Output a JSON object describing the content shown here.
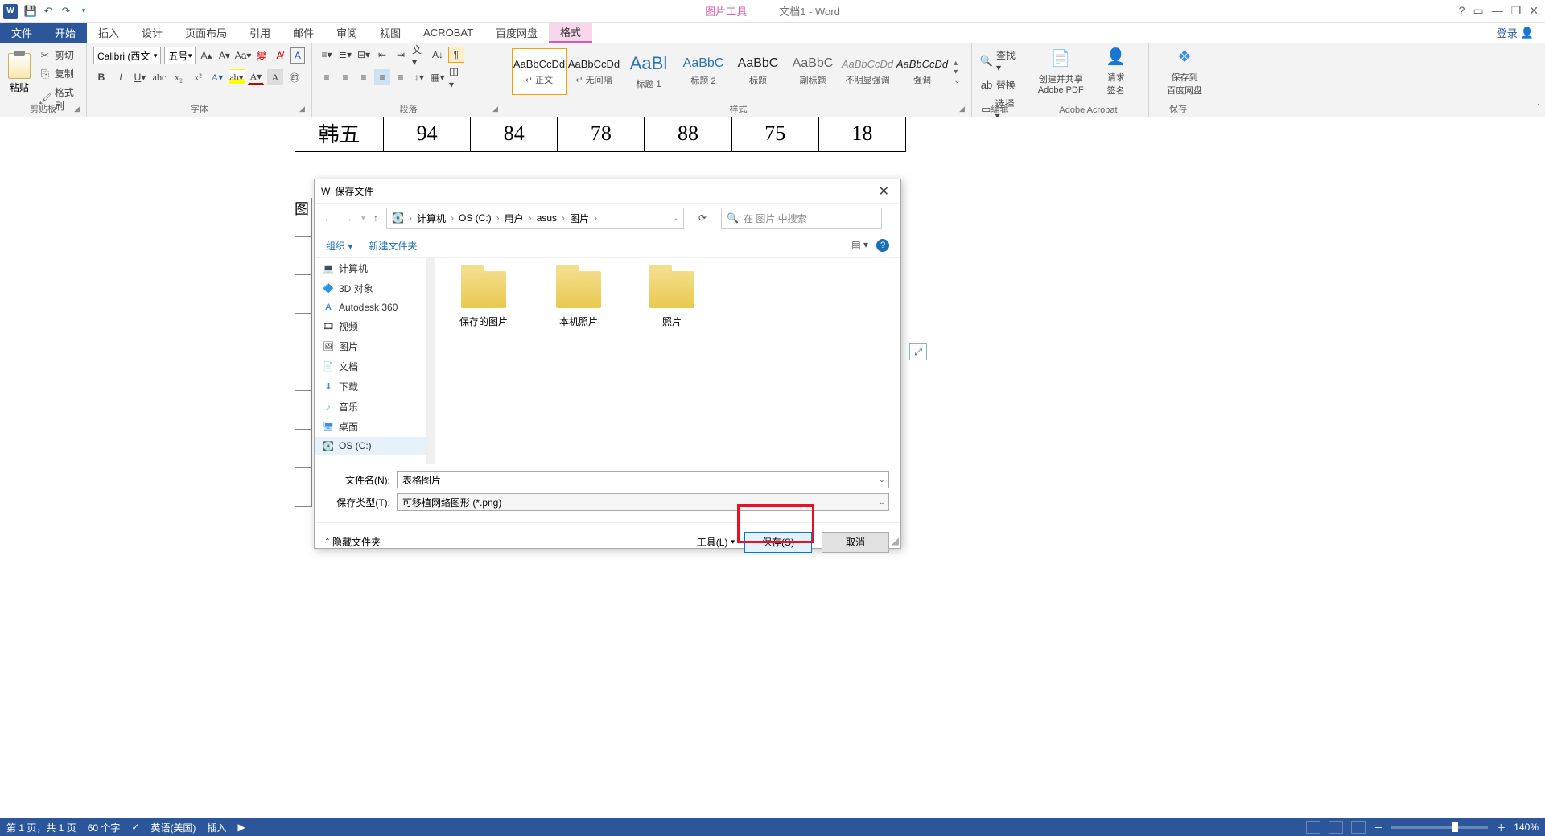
{
  "titlebar": {
    "contextual_tools": "图片工具",
    "doc_title": "文档1 - Word"
  },
  "tabs": {
    "file": "文件",
    "home": "开始",
    "insert": "插入",
    "design": "设计",
    "layout": "页面布局",
    "references": "引用",
    "mailings": "邮件",
    "review": "审阅",
    "view": "视图",
    "acrobat": "ACROBAT",
    "baidu": "百度网盘",
    "format": "格式",
    "login": "登录"
  },
  "ribbon": {
    "clipboard": {
      "label": "剪贴板",
      "paste": "粘贴",
      "cut": "剪切",
      "copy": "复制",
      "format_painter": "格式刷"
    },
    "font": {
      "label": "字体",
      "family": "Calibri (西文",
      "size": "五号"
    },
    "paragraph": {
      "label": "段落"
    },
    "styles": {
      "label": "样式",
      "items": [
        {
          "sample": "AaBbCcDd",
          "name": "↵ 正文"
        },
        {
          "sample": "AaBbCcDd",
          "name": "↵ 无间隔"
        },
        {
          "sample": "AaBl",
          "name": "标题 1"
        },
        {
          "sample": "AaBbC",
          "name": "标题 2"
        },
        {
          "sample": "AaBbC",
          "name": "标题"
        },
        {
          "sample": "AaBbC",
          "name": "副标题"
        },
        {
          "sample": "AaBbCcDd",
          "name": "不明显强调"
        },
        {
          "sample": "AaBbCcDd",
          "name": "强调"
        }
      ]
    },
    "editing": {
      "label": "编辑",
      "find": "查找 ▾",
      "replace": "替换",
      "select": "选择 ▾"
    },
    "adobe": {
      "label": "Adobe Acrobat",
      "create_share": "创建并共享\nAdobe PDF",
      "request_sig": "请求\n签名"
    },
    "save_group": {
      "label": "保存",
      "save_to": "保存到\n百度网盘"
    }
  },
  "table": {
    "row": [
      "韩五",
      "94",
      "84",
      "78",
      "88",
      "75",
      "18"
    ]
  },
  "caption": "图",
  "dialog": {
    "title": "保存文件",
    "path": [
      "计算机",
      "OS (C:)",
      "用户",
      "asus",
      "图片"
    ],
    "search_placeholder": "在 图片 中搜索",
    "organize": "组织 ▾",
    "new_folder": "新建文件夹",
    "tree": [
      {
        "icon": "💻",
        "label": "计算机"
      },
      {
        "icon": "🔷",
        "label": "3D 对象"
      },
      {
        "icon": "A",
        "label": "Autodesk 360"
      },
      {
        "icon": "🎞",
        "label": "视频"
      },
      {
        "icon": "🖼",
        "label": "图片"
      },
      {
        "icon": "📄",
        "label": "文档"
      },
      {
        "icon": "⬇",
        "label": "下载"
      },
      {
        "icon": "♪",
        "label": "音乐"
      },
      {
        "icon": "🖥",
        "label": "桌面"
      },
      {
        "icon": "💽",
        "label": "OS (C:)"
      }
    ],
    "folders": [
      "保存的图片",
      "本机照片",
      "照片"
    ],
    "filename_label": "文件名(N):",
    "filename_value": "表格图片",
    "filetype_label": "保存类型(T):",
    "filetype_value": "可移植网络图形 (*.png)",
    "hide_folders": "隐藏文件夹",
    "tools": "工具(L)",
    "save_btn": "保存(S)",
    "cancel_btn": "取消"
  },
  "statusbar": {
    "page": "第 1 页，共 1 页",
    "words": "60 个字",
    "lang": "英语(美国)",
    "mode": "插入",
    "zoom": "140%"
  }
}
